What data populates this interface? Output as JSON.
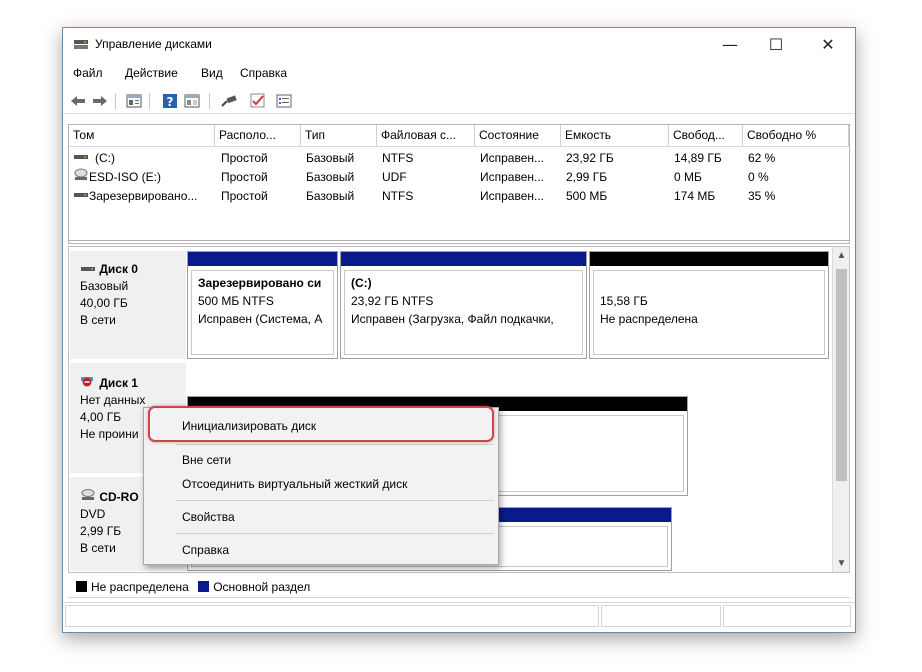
{
  "window": {
    "title": "Управление дисками",
    "minimize_glyph": "—",
    "maximize_glyph": "☐",
    "close_glyph": "✕"
  },
  "menu": {
    "file": "Файл",
    "action": "Действие",
    "view": "Вид",
    "help": "Справка"
  },
  "toolbar": {
    "icons": [
      "back-arrow-icon",
      "forward-arrow-icon",
      "properties-icon",
      "help-icon",
      "view-pane-icon",
      "connect-icon",
      "checkmark-icon",
      "list-icon"
    ]
  },
  "volumes": {
    "columns": [
      "Том",
      "Располо...",
      "Тип",
      "Файловая с...",
      "Состояние",
      "Емкость",
      "Свобод...",
      "Свободно %"
    ],
    "rows": [
      {
        "name": "(C:)",
        "layout": "Простой",
        "type": "Базовый",
        "fs": "NTFS",
        "status": "Исправен...",
        "capacity": "23,92 ГБ",
        "free": "14,89 ГБ",
        "free_pct": "62 %"
      },
      {
        "name": "ESD-ISO (E:)",
        "layout": "Простой",
        "type": "Базовый",
        "fs": "UDF",
        "status": "Исправен...",
        "capacity": "2,99 ГБ",
        "free": "0 МБ",
        "free_pct": "0 %"
      },
      {
        "name": "Зарезервировано...",
        "layout": "Простой",
        "type": "Базовый",
        "fs": "NTFS",
        "status": "Исправен...",
        "capacity": "500 МБ",
        "free": "174 МБ",
        "free_pct": "35 %"
      }
    ]
  },
  "disks": {
    "disk0": {
      "name": "Диск 0",
      "type": "Базовый",
      "size": "40,00 ГБ",
      "state": "В сети",
      "partitions": [
        {
          "title": "Зарезервировано си",
          "line1": "500 МБ NTFS",
          "line2": "Исправен (Система, А"
        },
        {
          "title": "(C:)",
          "line1": "23,92 ГБ NTFS",
          "line2": "Исправен (Загрузка, Файл подкачки,"
        },
        {
          "title": "",
          "line1": "15,58 ГБ",
          "line2": "Не распределена"
        }
      ]
    },
    "disk1": {
      "name": "Диск 1",
      "type": "Нет данных",
      "size": "4,00 ГБ",
      "state": "Не проини"
    },
    "cdrom": {
      "name": "CD-RO",
      "type": "DVD",
      "size": "2,99 ГБ",
      "state": "В сети"
    }
  },
  "legend": {
    "unallocated": "Не распределена",
    "primary": "Основной раздел",
    "unallocated_color": "#000000",
    "primary_color": "#0a1a8c"
  },
  "context_menu": {
    "initialize": "Инициализировать диск",
    "offline": "Вне сети",
    "detach_vhd": "Отсоединить виртуальный жесткий диск",
    "properties": "Свойства",
    "help": "Справка"
  },
  "colors": {
    "primary_bar": "#0a1a8c",
    "unallocated_bar": "#000000",
    "highlight": "#c9484d"
  }
}
